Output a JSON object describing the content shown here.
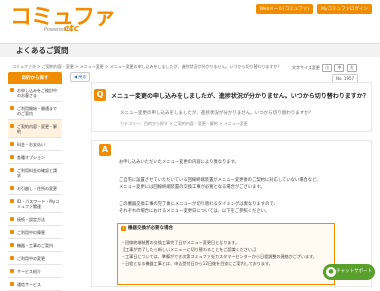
{
  "header": {
    "logo": "コミュファ",
    "powered_by": "Powered by",
    "brand_ctc": "ctc",
    "top_links": [
      "Webメール(コミュファ)",
      "Myコミュファログイン"
    ]
  },
  "page_title": "よくあるご質問",
  "breadcrumb": "コミュファ光 > ご契約内容・変更 > メニュー変更 > メニュー変更の申し込みをしましたが、進捗状況が分かりません。いつから切り替わりますか？",
  "font_size": {
    "label": "文字サイズ変更",
    "options": [
      "小",
      "中",
      "大"
    ]
  },
  "sidebar": {
    "title": "目的から探す",
    "items": [
      "お申し込みをご検討中のお客さま",
      "ご利用開始・開通までのご案内",
      "ご契約内容・変更・解約",
      "料金・お支払い",
      "各種オプション",
      "ご利用料金の確認と請求",
      "お引越し・住所の変更",
      "ID・パスワード・Myコミュファ関連",
      "接続・設定方法",
      "ご利用中の障害",
      "機器・工事のご案内",
      "ご利用中の変更",
      "サービス紹介",
      "通信サービス"
    ]
  },
  "toolbar": {
    "back": "◀ 戻る",
    "views": "No. 1957"
  },
  "question": {
    "icon": "Q",
    "title": "メニュー変更の申し込みをしましたが、進捗状況が分かりません。いつから切り替わりますか？",
    "sub": "メニュー変更の申し込みをしましたが、進捗状況が分かりません。いつから切り替わりますか？",
    "category": "カテゴリー：目的から探す > ご契約内容・変更・解約 > メニュー変更"
  },
  "answer": {
    "icon": "A",
    "lines": [
      "お申し込みいただいたメニュー変更の内容により異なります。",
      "",
      "ご自宅に設置させていただいている回線終端装置がメニュー変更後のご契約に対応していない場合など、",
      "メニュー変更には回線終端装置の交換工事が必要となる場合がございます。",
      "",
      "この機器交換工事の完了後にメニューが切り替わるタイミングは異なりますので、",
      "それぞれの場合におけるメニュー変更日については、以下をご参照ください。"
    ]
  },
  "notice": {
    "head": "機器交換が必要な場合",
    "lines": [
      "・回線終端装置の交換工事完了日がメニュー変更日となります。",
      "【工事が完了したら新しいメニューに切り替わることをご認識ください。】",
      "・工事日については、準備ができ次第コミュファ光カスタマーセンターから日程調整の連絡がございます。",
      "・日程となる機器工事とは、申込受付日から12日後を目安にご案内しております。"
    ]
  },
  "chat": {
    "label": "チャットサポート"
  }
}
